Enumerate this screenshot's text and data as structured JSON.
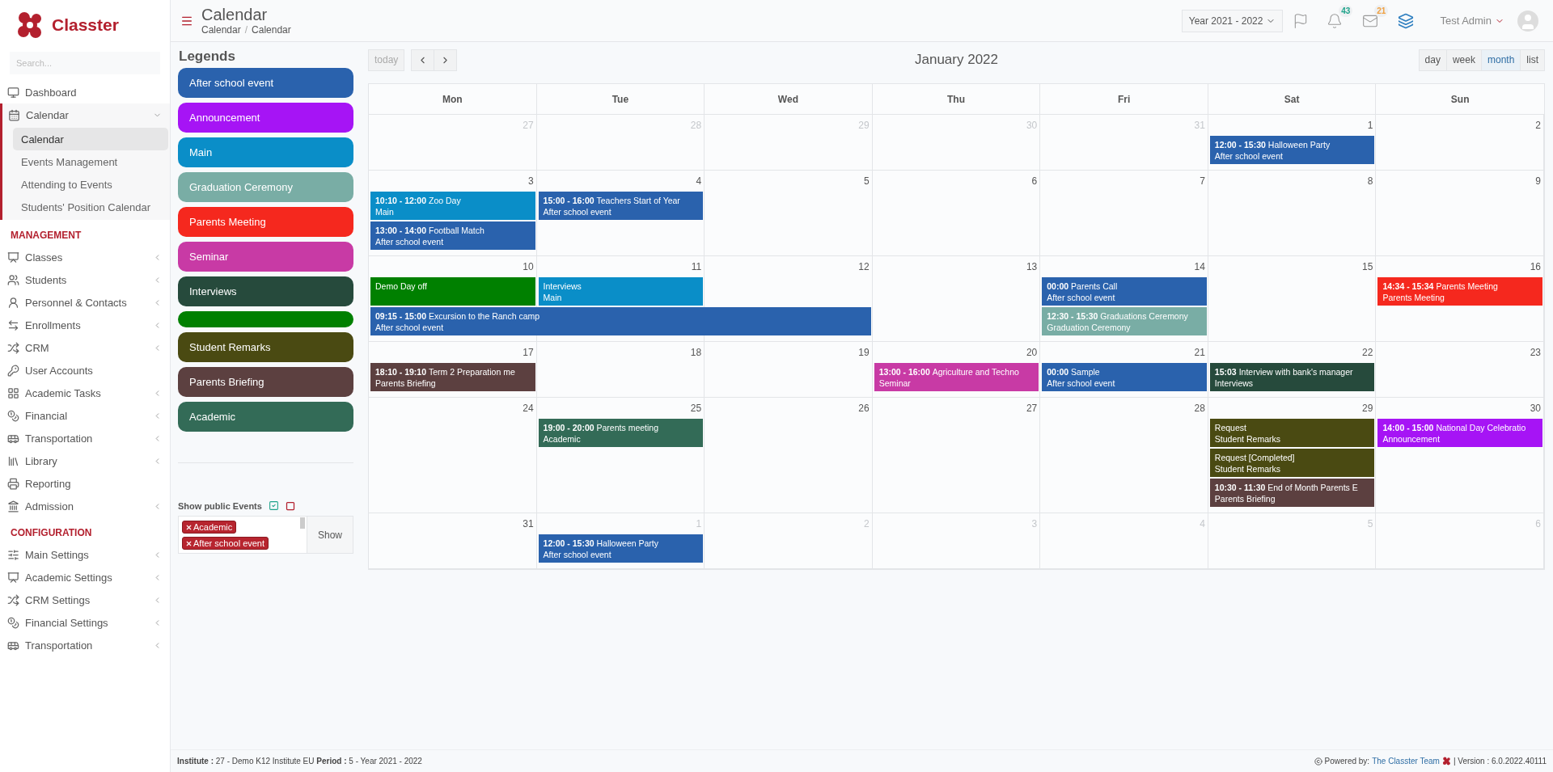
{
  "brand": {
    "name": "Classter"
  },
  "sidebar": {
    "search": {
      "placeholder": "Search..."
    },
    "items": [
      {
        "label": "Dashboard",
        "has_submenu": false,
        "expanded": false
      },
      {
        "label": "Calendar",
        "has_submenu": true,
        "expanded": true,
        "children": [
          {
            "label": "Calendar",
            "selected": true
          },
          {
            "label": "Events Management",
            "selected": false
          },
          {
            "label": "Attending to Events",
            "selected": false
          },
          {
            "label": "Students' Position Calendar",
            "selected": false
          }
        ]
      }
    ],
    "sections": [
      {
        "heading": "MANAGEMENT",
        "items": [
          {
            "label": "Classes",
            "has_submenu": true
          },
          {
            "label": "Students",
            "has_submenu": true
          },
          {
            "label": "Personnel & Contacts",
            "has_submenu": true
          },
          {
            "label": "Enrollments",
            "has_submenu": true
          },
          {
            "label": "CRM",
            "has_submenu": true
          },
          {
            "label": "User Accounts",
            "has_submenu": false
          },
          {
            "label": "Academic Tasks",
            "has_submenu": true
          },
          {
            "label": "Financial",
            "has_submenu": true
          },
          {
            "label": "Transportation",
            "has_submenu": true
          },
          {
            "label": "Library",
            "has_submenu": true
          },
          {
            "label": "Reporting",
            "has_submenu": false
          },
          {
            "label": "Admission",
            "has_submenu": true
          }
        ]
      },
      {
        "heading": "CONFIGURATION",
        "items": [
          {
            "label": "Main Settings",
            "has_submenu": true
          },
          {
            "label": "Academic Settings",
            "has_submenu": true
          },
          {
            "label": "CRM Settings",
            "has_submenu": true
          },
          {
            "label": "Financial Settings",
            "has_submenu": true
          },
          {
            "label": "Transportation",
            "has_submenu": true
          }
        ]
      }
    ]
  },
  "header": {
    "title": "Calendar",
    "breadcrumb": [
      "Calendar",
      "Calendar"
    ],
    "breadcrumb_separator": "/",
    "year_select": "Year 2021 - 2022",
    "notifications": "43",
    "messages": "21",
    "user": "Test Admin"
  },
  "legends": {
    "title": "Legends",
    "items": [
      {
        "label": "After school event",
        "color": "#2a62ad"
      },
      {
        "label": "Announcement",
        "color": "#a614f5"
      },
      {
        "label": "Main",
        "color": "#0a8ec8"
      },
      {
        "label": "Graduation Ceremony",
        "color": "#79ada5"
      },
      {
        "label": "Parents Meeting",
        "color": "#f5281e"
      },
      {
        "label": "Seminar",
        "color": "#c83aa5"
      },
      {
        "label": "Interviews",
        "color": "#264a3c"
      },
      {
        "color": "#008000"
      },
      {
        "label": "Student Remarks",
        "color": "#4a4a12"
      },
      {
        "label": "Parents Briefing",
        "color": "#5c4040"
      },
      {
        "label": "Academic",
        "color": "#336b57"
      }
    ]
  },
  "public_events": {
    "label": "Show public Events",
    "show_checked": true,
    "tags": [
      "Academic",
      "After school event"
    ],
    "button": "Show"
  },
  "calendar": {
    "today_button": "today",
    "today_disabled": true,
    "title": "January 2022",
    "views": [
      {
        "label": "day",
        "selected": false
      },
      {
        "label": "week",
        "selected": false
      },
      {
        "label": "month",
        "selected": true
      },
      {
        "label": "list",
        "selected": false
      }
    ],
    "weekdays": [
      "Mon",
      "Tue",
      "Wed",
      "Thu",
      "Fri",
      "Sat",
      "Sun"
    ],
    "weeks": [
      {
        "days": [
          {
            "number": "27",
            "other_month": true
          },
          {
            "number": "28",
            "other_month": true
          },
          {
            "number": "29",
            "other_month": true
          },
          {
            "number": "30",
            "other_month": true
          },
          {
            "number": "31",
            "other_month": true
          },
          {
            "number": "1",
            "other_month": false,
            "events": [
              {
                "time": "12:00 - 15:30",
                "title": "Halloween Party",
                "category": "After school event",
                "color": "#2a62ad"
              }
            ]
          },
          {
            "number": "2",
            "other_month": false
          }
        ]
      },
      {
        "days": [
          {
            "number": "3",
            "other_month": false,
            "events": [
              {
                "time": "10:10 - 12:00",
                "title": "Zoo Day",
                "category": "Main",
                "color": "#0a8ec8"
              },
              {
                "time": "13:00 - 14:00",
                "title": "Football Match",
                "category": "After school event",
                "color": "#2a62ad"
              }
            ]
          },
          {
            "number": "4",
            "other_month": false,
            "events": [
              {
                "time": "15:00 - 16:00",
                "title": "Teachers Start of Year",
                "category": "After school event",
                "color": "#2a62ad"
              }
            ]
          },
          {
            "number": "5",
            "other_month": false
          },
          {
            "number": "6",
            "other_month": false
          },
          {
            "number": "7",
            "other_month": false
          },
          {
            "number": "8",
            "other_month": false
          },
          {
            "number": "9",
            "other_month": false
          }
        ]
      },
      {
        "days": [
          {
            "number": "10",
            "other_month": false,
            "events": [
              {
                "title": "Demo Day off",
                "color": "#008000"
              },
              {
                "time": "09:15 - 15:00",
                "title": "Excursion to the Ranch camp",
                "category": "After school event",
                "color": "#2a62ad",
                "multi_day": true
              }
            ]
          },
          {
            "number": "11",
            "other_month": false,
            "carried_over": true,
            "events": [
              {
                "title": "Interviews",
                "category": "Main",
                "color": "#0a8ec8"
              }
            ]
          },
          {
            "number": "12",
            "other_month": false,
            "carried_over": true
          },
          {
            "number": "13",
            "other_month": false
          },
          {
            "number": "14",
            "other_month": false,
            "events": [
              {
                "time": "00:00",
                "title": "Parents Call",
                "category": "After school event",
                "color": "#2a62ad"
              },
              {
                "time": "12:30 - 15:30",
                "title": "Graduations Ceremony",
                "category": "Graduation Ceremony",
                "color": "#79ada5"
              }
            ]
          },
          {
            "number": "15",
            "other_month": false
          },
          {
            "number": "16",
            "other_month": false,
            "events": [
              {
                "time": "14:34 - 15:34",
                "title": "Parents Meeting",
                "category": "Parents Meeting",
                "color": "#f5281e"
              }
            ]
          }
        ]
      },
      {
        "days": [
          {
            "number": "17",
            "other_month": false,
            "events": [
              {
                "time": "18:10 - 19:10",
                "title": "Term 2 Preparation me",
                "category": "Parents Briefing",
                "color": "#5c4040"
              }
            ]
          },
          {
            "number": "18",
            "other_month": false
          },
          {
            "number": "19",
            "other_month": false
          },
          {
            "number": "20",
            "other_month": false,
            "events": [
              {
                "time": "13:00 - 16:00",
                "title": "Agriculture and Techno",
                "category": "Seminar",
                "color": "#c83aa5"
              }
            ]
          },
          {
            "number": "21",
            "other_month": false,
            "events": [
              {
                "time": "00:00",
                "title": "Sample",
                "category": "After school event",
                "color": "#2a62ad"
              }
            ]
          },
          {
            "number": "22",
            "other_month": false,
            "events": [
              {
                "time": "15:03",
                "title": "Interview with bank's manager",
                "category": "Interviews",
                "color": "#264a3c"
              }
            ]
          },
          {
            "number": "23",
            "other_month": false
          }
        ]
      },
      {
        "days": [
          {
            "number": "24",
            "other_month": false
          },
          {
            "number": "25",
            "other_month": false,
            "events": [
              {
                "time": "19:00 - 20:00",
                "title": "Parents meeting",
                "category": "Academic",
                "color": "#336b57"
              }
            ]
          },
          {
            "number": "26",
            "other_month": false
          },
          {
            "number": "27",
            "other_month": false
          },
          {
            "number": "28",
            "other_month": false
          },
          {
            "number": "29",
            "other_month": false,
            "events": [
              {
                "title": "Request",
                "category": "Student Remarks",
                "color": "#4a4a12"
              },
              {
                "title": "Request [Completed]",
                "category": "Student Remarks",
                "color": "#4a4a12"
              },
              {
                "time": "10:30 - 11:30",
                "title": "End of Month Parents E",
                "category": "Parents Briefing",
                "color": "#5c4040"
              }
            ]
          },
          {
            "number": "30",
            "other_month": false,
            "events": [
              {
                "time": "14:00 - 15:00",
                "title": "National Day Celebratio",
                "category": "Announcement",
                "color": "#a614f5"
              }
            ]
          }
        ]
      },
      {
        "days": [
          {
            "number": "31",
            "other_month": false
          },
          {
            "number": "1",
            "other_month": true,
            "events": [
              {
                "time": "12:00 - 15:30",
                "title": "Halloween Party",
                "category": "After school event",
                "color": "#2a62ad"
              }
            ]
          },
          {
            "number": "2",
            "other_month": true
          },
          {
            "number": "3",
            "other_month": true
          },
          {
            "number": "4",
            "other_month": true
          },
          {
            "number": "5",
            "other_month": true
          },
          {
            "number": "6",
            "other_month": true
          }
        ]
      }
    ]
  },
  "footer": {
    "info": "**Institute :** 27 - Demo K12 Institute EU **Period :** 5 - Year 2021 - 2022",
    "powered_by": "Powered by:",
    "team_link": "The Classter Team",
    "version": "| Version : 6.0.2022.40111"
  }
}
